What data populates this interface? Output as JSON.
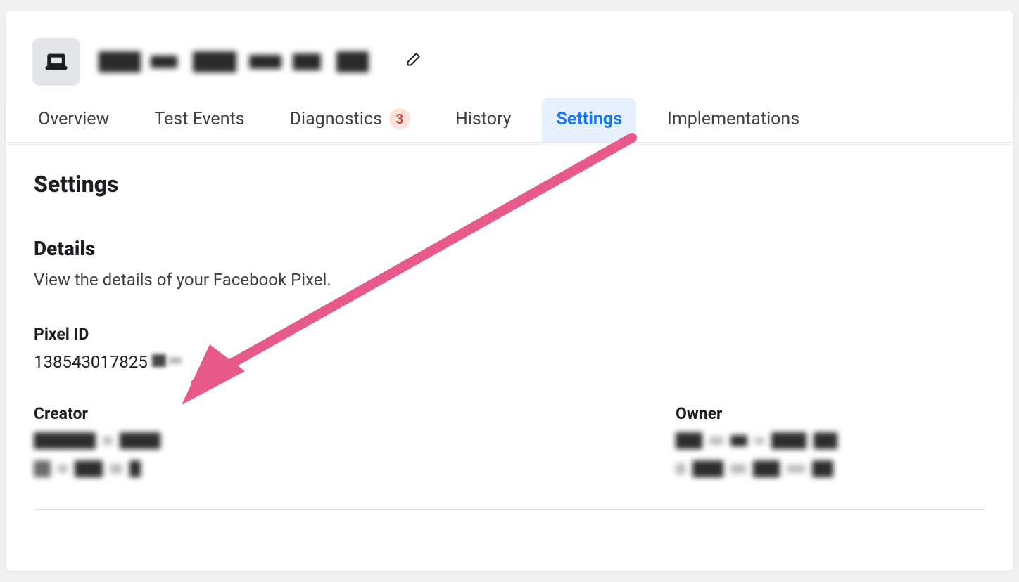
{
  "header": {
    "title_redacted": true,
    "edit_label": "Edit"
  },
  "tabs": [
    {
      "key": "overview",
      "label": "Overview",
      "active": false
    },
    {
      "key": "test-events",
      "label": "Test Events",
      "active": false
    },
    {
      "key": "diagnostics",
      "label": "Diagnostics",
      "badge": "3",
      "active": false
    },
    {
      "key": "history",
      "label": "History",
      "active": false
    },
    {
      "key": "settings",
      "label": "Settings",
      "active": true
    },
    {
      "key": "implementations",
      "label": "Implementations",
      "active": false
    }
  ],
  "page": {
    "title": "Settings",
    "details_heading": "Details",
    "details_desc": "View the details of your Facebook Pixel.",
    "pixel_id_label": "Pixel ID",
    "pixel_id_visible": "138543017825",
    "creator_label": "Creator",
    "owner_label": "Owner"
  },
  "annotation": {
    "arrow_color": "#e85a8a",
    "target": "pixel-id"
  }
}
